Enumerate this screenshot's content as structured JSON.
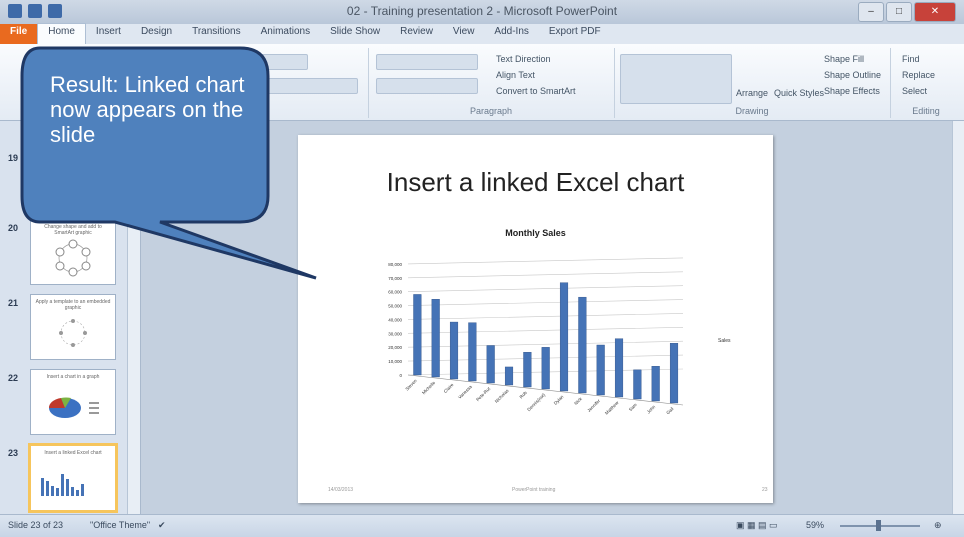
{
  "window": {
    "title": "02 - Training presentation 2 - Microsoft PowerPoint"
  },
  "tabs": [
    "File",
    "Home",
    "Insert",
    "Design",
    "Transitions",
    "Animations",
    "Slide Show",
    "Review",
    "View",
    "Add-Ins",
    "Export PDF"
  ],
  "active_tab": "Home",
  "ribbon": {
    "paragraph_label": "Paragraph",
    "drawing_label": "Drawing",
    "editing_label": "Editing",
    "text_direction": "Text Direction",
    "align_text": "Align Text",
    "convert_smartart": "Convert to SmartArt",
    "arrange": "Arrange",
    "quick_styles": "Quick Styles",
    "shape_fill": "Shape Fill",
    "shape_outline": "Shape Outline",
    "shape_effects": "Shape Effects",
    "find": "Find",
    "replace": "Replace",
    "select": "Select"
  },
  "thumbnails": [
    {
      "num": "19",
      "title": ""
    },
    {
      "num": "20",
      "title": "Change shape and add to SmartArt graphic"
    },
    {
      "num": "21",
      "title": "Apply a template to an embedded graphic"
    },
    {
      "num": "22",
      "title": "Insert a chart in a graph"
    },
    {
      "num": "23",
      "title": "Insert a linked Excel chart"
    }
  ],
  "slide": {
    "title": "Insert a linked Excel chart",
    "footer_date": "14/03/2013",
    "footer_text": "PowerPoint training",
    "footer_num": "23"
  },
  "chart_data": {
    "type": "bar",
    "title": "Monthly Sales",
    "categories": [
      "Steven",
      "Michelle",
      "Claire",
      "Vanessa",
      "Pete-Rut",
      "Nicholas",
      "Rob",
      "Dennis(not)",
      "Dylan",
      "Nick",
      "Jennifer",
      "Matthew",
      "Sam",
      "John",
      "Gail"
    ],
    "values": [
      58000,
      56000,
      41000,
      42000,
      27000,
      13000,
      25000,
      30000,
      78000,
      69000,
      36000,
      42000,
      21000,
      25000,
      43000
    ],
    "ylim": [
      0,
      90000
    ],
    "yticks": [
      "0",
      "10,000",
      "20,000",
      "30,000",
      "40,000",
      "50,000",
      "60,000",
      "70,000",
      "80,000"
    ],
    "legend": "Sales",
    "color": "#4573b6"
  },
  "statusbar": {
    "slide_info": "Slide 23 of 23",
    "theme": "\"Office Theme\"",
    "zoom": "59%"
  },
  "callout": {
    "text": "Result: Linked chart now appears on the slide",
    "fill": "#4f81bd"
  }
}
